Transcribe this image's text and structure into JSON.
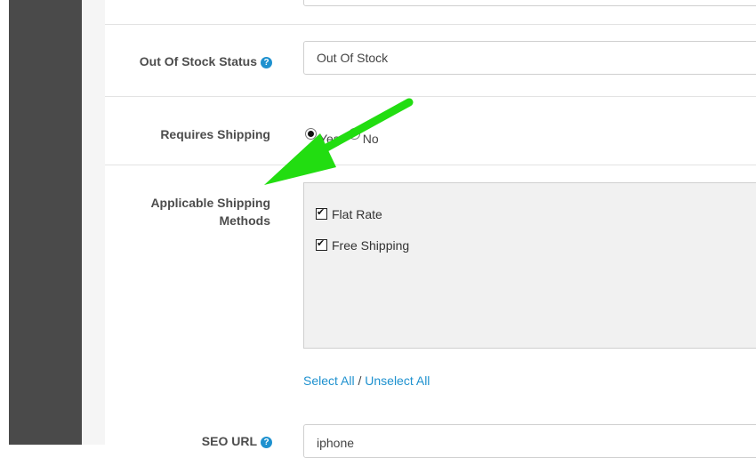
{
  "form": {
    "stock_status": {
      "label": "Out Of Stock Status",
      "value": "Out Of Stock"
    },
    "requires_shipping": {
      "label": "Requires Shipping",
      "options": [
        {
          "label": "Yes",
          "checked": true
        },
        {
          "label": "No",
          "checked": false
        }
      ]
    },
    "shipping_methods": {
      "label_line1": "Applicable Shipping",
      "label_line2": "Methods",
      "items": [
        {
          "label": "Flat Rate",
          "checked": true
        },
        {
          "label": "Free Shipping",
          "checked": true
        }
      ],
      "select_all": "Select All",
      "separator": " / ",
      "unselect_all": "Unselect All"
    },
    "seo_url": {
      "label": "SEO URL",
      "value": "iphone"
    }
  },
  "icons": {
    "help": "question-circle-icon",
    "annotation": "green-arrow-annotation"
  },
  "colors": {
    "sidebar": "#4a4a4a",
    "link": "#1e91cf",
    "arrow": "#22dd11"
  }
}
